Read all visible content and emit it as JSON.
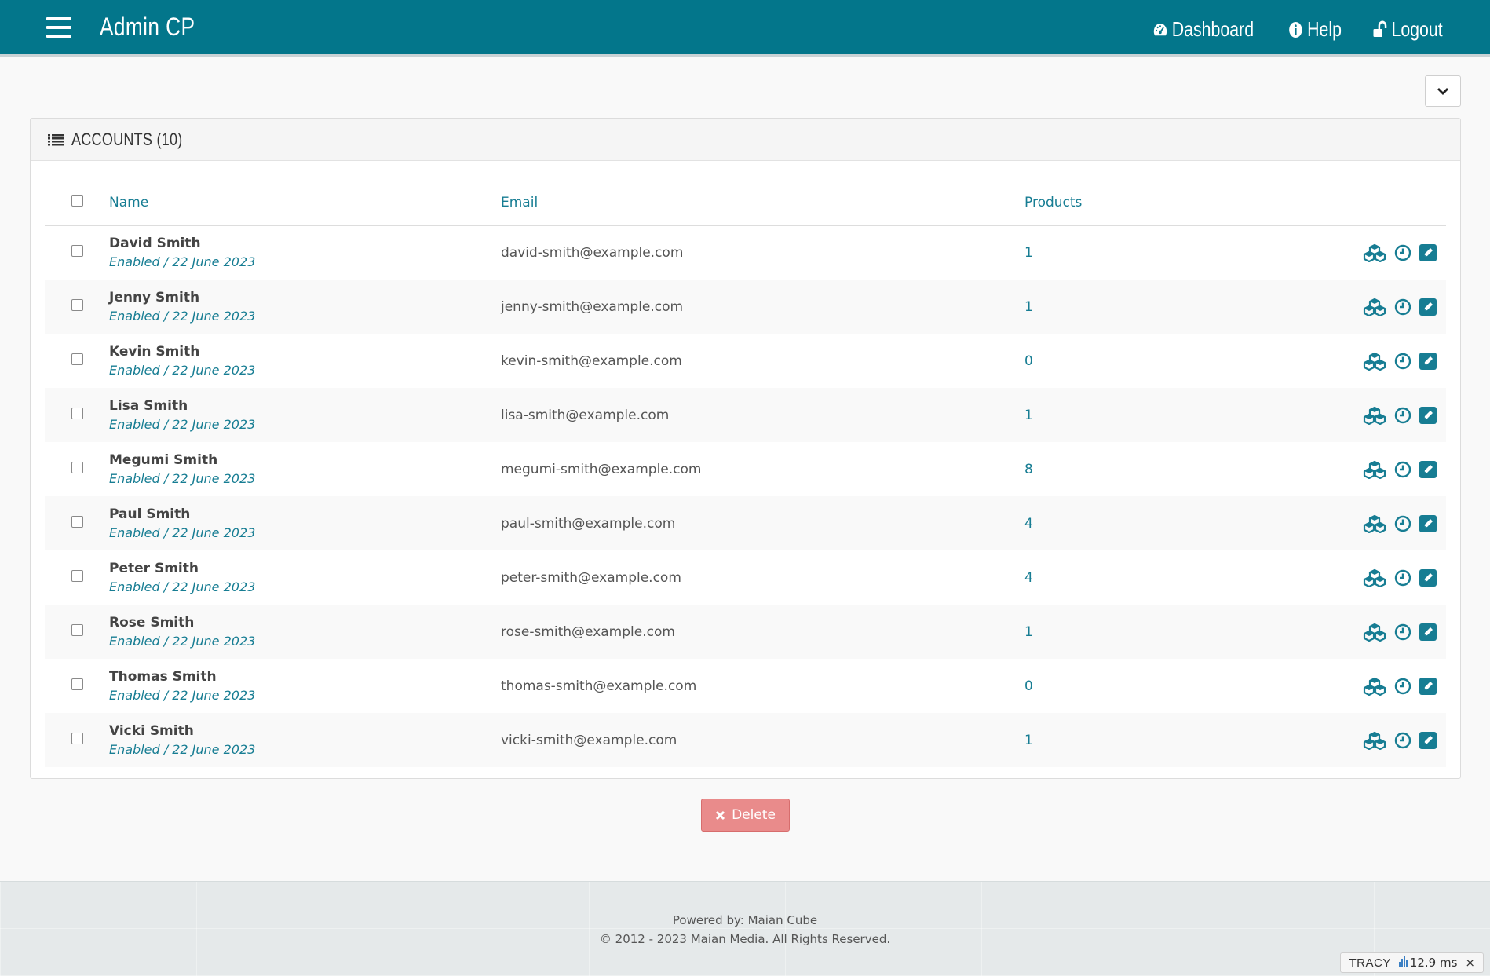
{
  "header": {
    "brand": "Admin CP",
    "nav": [
      {
        "label": "Dashboard",
        "icon": "dashboard-icon"
      },
      {
        "label": "Help",
        "icon": "info-icon"
      },
      {
        "label": "Logout",
        "icon": "unlock-icon"
      }
    ]
  },
  "panel": {
    "title": "ACCOUNTS (10)",
    "columns": {
      "name": "Name",
      "email": "Email",
      "products": "Products"
    }
  },
  "accounts": [
    {
      "name": "David Smith",
      "status": "Enabled / 22 June 2023",
      "email": "david-smith@example.com",
      "products": "1"
    },
    {
      "name": "Jenny Smith",
      "status": "Enabled / 22 June 2023",
      "email": "jenny-smith@example.com",
      "products": "1"
    },
    {
      "name": "Kevin Smith",
      "status": "Enabled / 22 June 2023",
      "email": "kevin-smith@example.com",
      "products": "0"
    },
    {
      "name": "Lisa Smith",
      "status": "Enabled / 22 June 2023",
      "email": "lisa-smith@example.com",
      "products": "1"
    },
    {
      "name": "Megumi Smith",
      "status": "Enabled / 22 June 2023",
      "email": "megumi-smith@example.com",
      "products": "8"
    },
    {
      "name": "Paul Smith",
      "status": "Enabled / 22 June 2023",
      "email": "paul-smith@example.com",
      "products": "4"
    },
    {
      "name": "Peter Smith",
      "status": "Enabled / 22 June 2023",
      "email": "peter-smith@example.com",
      "products": "4"
    },
    {
      "name": "Rose Smith",
      "status": "Enabled / 22 June 2023",
      "email": "rose-smith@example.com",
      "products": "1"
    },
    {
      "name": "Thomas Smith",
      "status": "Enabled / 22 June 2023",
      "email": "thomas-smith@example.com",
      "products": "0"
    },
    {
      "name": "Vicki Smith",
      "status": "Enabled / 22 June 2023",
      "email": "vicki-smith@example.com",
      "products": "1"
    }
  ],
  "row_actions": [
    "cubes-icon",
    "clock-icon",
    "edit-icon"
  ],
  "delete_label": "Delete",
  "footer": {
    "powered": "Powered by: Maian Cube",
    "copyright": "© 2012 - 2023 Maian Media. All Rights Reserved."
  },
  "tracy": {
    "label": "TRACY",
    "time": "12.9 ms",
    "close": "×"
  },
  "colors": {
    "brand": "#03768b",
    "link": "#177d93",
    "delete": "#e98b8b"
  }
}
